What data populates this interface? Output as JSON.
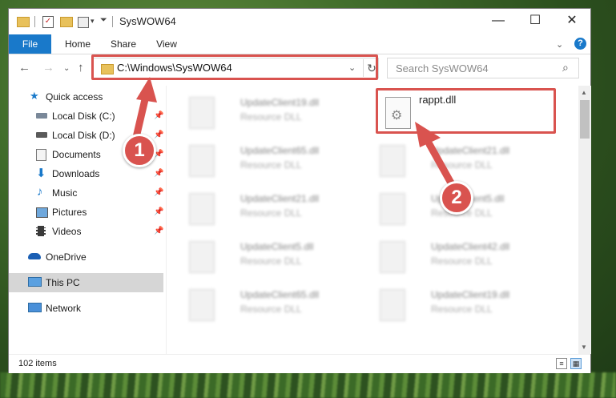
{
  "window": {
    "title": "SysWOW64"
  },
  "ribbon": {
    "tabs": [
      "File",
      "Home",
      "Share",
      "View"
    ],
    "help": "?"
  },
  "address": {
    "path": "C:\\Windows\\SysWOW64"
  },
  "search": {
    "placeholder": "Search SysWOW64"
  },
  "sidebar": {
    "items": [
      {
        "label": "Quick access",
        "icon": "star-icon"
      },
      {
        "label": "Local Disk (C:)",
        "icon": "drive-icon"
      },
      {
        "label": "Local Disk (D:)",
        "icon": "drive-icon"
      },
      {
        "label": "Documents",
        "icon": "documents-icon"
      },
      {
        "label": "Downloads",
        "icon": "download-icon"
      },
      {
        "label": "Music",
        "icon": "music-icon"
      },
      {
        "label": "Pictures",
        "icon": "pictures-icon"
      },
      {
        "label": "Videos",
        "icon": "videos-icon"
      },
      {
        "label": "OneDrive",
        "icon": "cloud-icon"
      },
      {
        "label": "This PC",
        "icon": "computer-icon"
      },
      {
        "label": "Network",
        "icon": "network-icon"
      }
    ]
  },
  "files": [
    {
      "name": "UpdateClient19.dll",
      "type": "Resource DLL"
    },
    {
      "name": "rappt.dll",
      "type": ""
    },
    {
      "name": "UpdateClient65.dll",
      "type": "Resource DLL"
    },
    {
      "name": "UpdateClient21.dll",
      "type": "Resource DLL"
    },
    {
      "name": "UpdateClient21.dll",
      "type": "Resource DLL"
    },
    {
      "name": "UpdateClient5.dll",
      "type": "Resource DLL"
    },
    {
      "name": "UpdateClient5.dll",
      "type": "Resource DLL"
    },
    {
      "name": "UpdateClient42.dll",
      "type": "Resource DLL"
    },
    {
      "name": "UpdateClient65.dll",
      "type": "Resource DLL"
    },
    {
      "name": "UpdateClient19.dll",
      "type": "Resource DLL"
    }
  ],
  "status": {
    "items": "102 items"
  },
  "annotations": {
    "step1": "1",
    "step2": "2"
  },
  "colors": {
    "accent": "#1979ca",
    "highlight": "#d9534f"
  }
}
